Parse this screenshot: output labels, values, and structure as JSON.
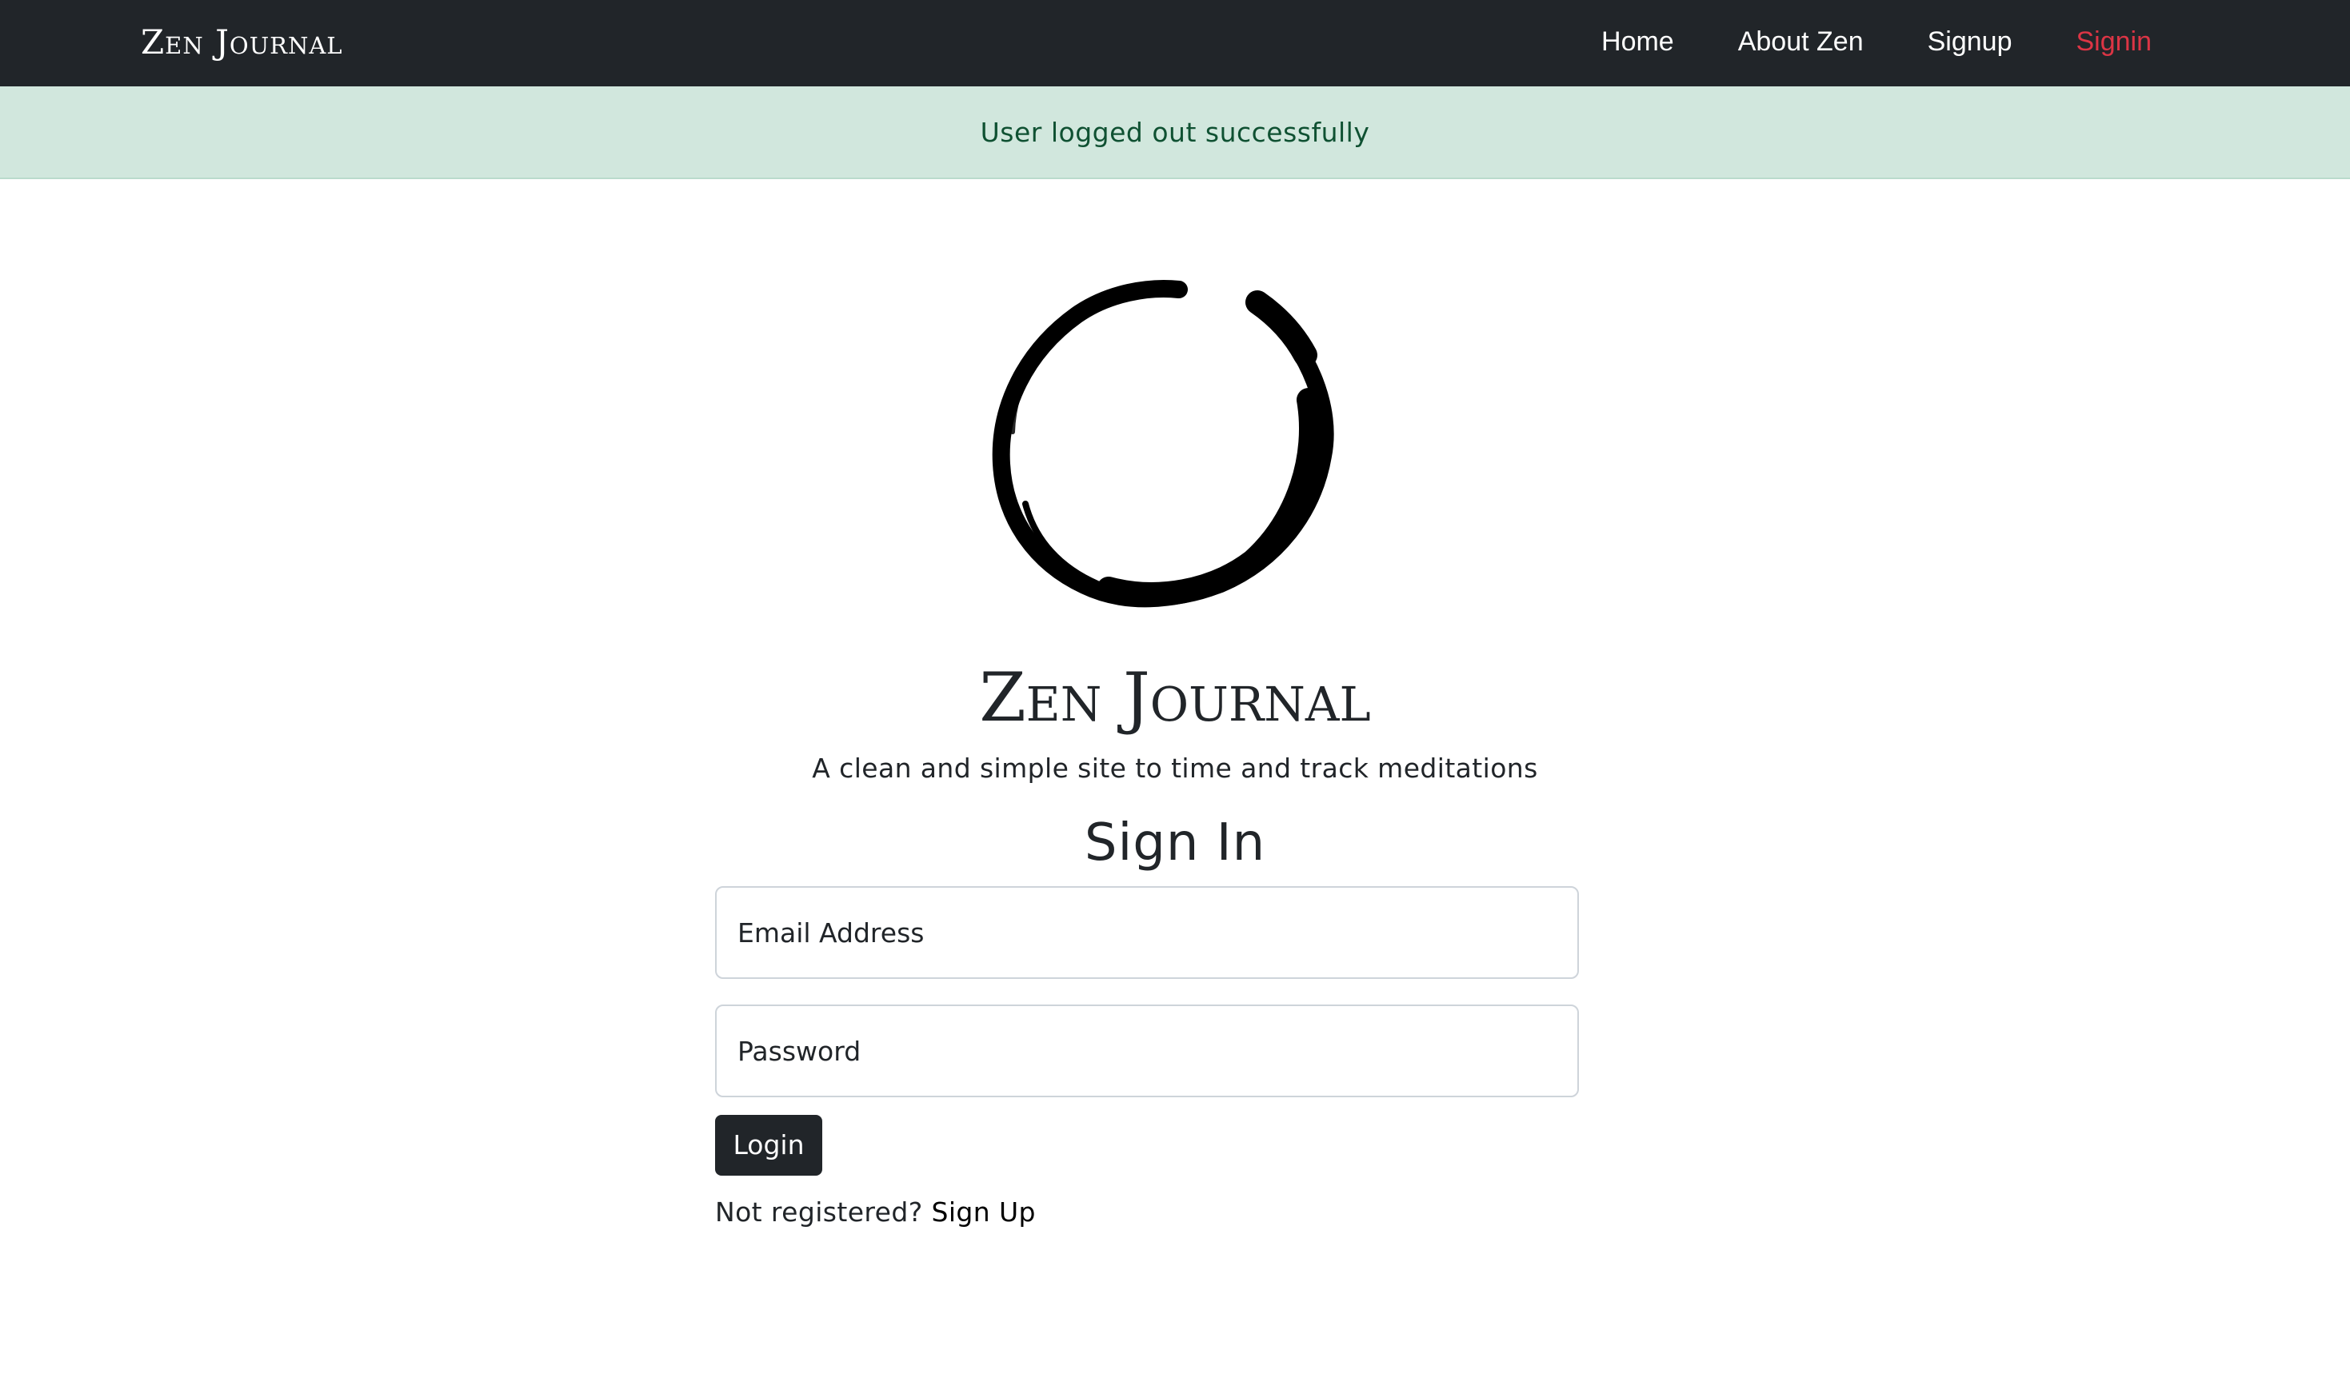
{
  "navbar": {
    "brand": "Zen Journal",
    "links": [
      {
        "label": "Home",
        "active": false
      },
      {
        "label": "About Zen",
        "active": false
      },
      {
        "label": "Signup",
        "active": false
      },
      {
        "label": "Signin",
        "active": true
      }
    ],
    "background_color": "#212529",
    "active_color": "#dc3545"
  },
  "alert": {
    "message": "User logged out successfully",
    "background_color": "#d1e7dd",
    "text_color": "#0f5132"
  },
  "hero": {
    "logo_icon": "enso-circle-icon",
    "title": "Zen Journal",
    "tagline": "A clean and simple site to time and track meditations"
  },
  "signin_form": {
    "heading": "Sign In",
    "email_placeholder": "Email Address",
    "password_placeholder": "Password",
    "submit_label": "Login",
    "register_prompt": "Not registered?",
    "register_link": "Sign Up"
  }
}
